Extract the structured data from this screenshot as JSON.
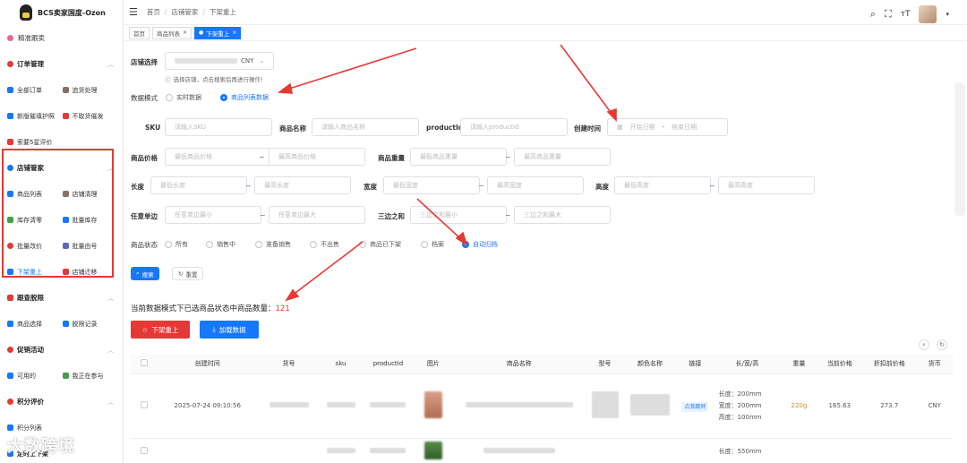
{
  "app_title": "BCS卖家国度-Ozon",
  "sidebar": {
    "top_item": "精准跟卖",
    "groups": [
      {
        "title": "订单管理",
        "items": [
          "全部订单",
          "追货处理",
          "新版催填护照",
          "不取货催发",
          "索要5星评价"
        ]
      },
      {
        "title": "店铺管家",
        "items": [
          "商品列表",
          "店铺清理",
          "库存清零",
          "批量库存",
          "批量改价",
          "批量由号",
          "下架重上",
          "店铺迁移"
        ]
      },
      {
        "title": "跟查脱限",
        "items": [
          "商品选择",
          "脱限记录"
        ]
      },
      {
        "title": "促销活动",
        "items": [
          "可用的",
          "我正在参与"
        ]
      },
      {
        "title": "积分评价",
        "items": [
          "积分列表",
          "定时上下架"
        ]
      }
    ],
    "active_item": "下架重上"
  },
  "breadcrumb": [
    "首页",
    "店铺管家",
    "下架重上"
  ],
  "tabs": [
    {
      "label": "首页"
    },
    {
      "label": "商品列表"
    },
    {
      "label": "下架重上"
    }
  ],
  "form": {
    "store_label": "店铺选择",
    "store_value": "CNY",
    "store_hint": "选择店铺，点击搜索后再进行操作!",
    "mode_label": "数据模式",
    "mode_options": [
      "实时数据",
      "商品列表数据"
    ],
    "sku_label": "SKU",
    "sku_placeholder": "请输入SKU",
    "name_label": "商品名称",
    "name_placeholder": "请输入商品名称",
    "pid_label": "productId",
    "pid_placeholder": "请输入productId",
    "created_label": "创建时间",
    "start_date": "开始日期",
    "date_sep": "-",
    "end_date": "结束日期",
    "price_label": "商品价格",
    "price_min": "最低商品价格",
    "price_max": "最高商品价格",
    "weight_label": "商品重量",
    "weight_min": "最低商品重量",
    "weight_max": "最高商品重量",
    "length_label": "长度",
    "length_min": "最低长度",
    "length_max": "最高长度",
    "width_label": "宽度",
    "width_min": "最低宽度",
    "width_max": "最高宽度",
    "height_label": "高度",
    "height_min": "最低高度",
    "height_max": "最高高度",
    "side_label": "任意单边",
    "side_min": "任意单边最小",
    "side_max": "任意单边最大",
    "sum_label": "三边之和",
    "sum_min": "三边之和最小",
    "sum_max": "三边之和最大",
    "tilde": "~",
    "status_label": "商品状态",
    "status_options": [
      "所有",
      "销售中",
      "准备销售",
      "不出售",
      "商品已下架",
      "档案",
      "自动归档"
    ],
    "search_btn": "搜索",
    "reset_btn": "重置"
  },
  "count_text": "当前数据模式下已选商品状态中商品数量：",
  "count_value": "121",
  "actions": {
    "relist": "下架重上",
    "load": "加载数据"
  },
  "table": {
    "headers": [
      "创建时间",
      "货号",
      "sku",
      "productId",
      "图片",
      "商品名称",
      "型号",
      "颜色名称",
      "链接",
      "长/宽/高",
      "重量",
      "当前价格",
      "折扣前价格",
      "货币"
    ],
    "rows": [
      {
        "created": "2025-07-24 09:10:56",
        "link": "点我跳转",
        "dims": [
          "长度：200mm",
          "宽度：200mm",
          "高度：100mm"
        ],
        "weight": "220g",
        "price": "165.63",
        "old_price": "273.7",
        "currency": "CNY"
      },
      {
        "dims": [
          "长度：550mm"
        ]
      }
    ]
  },
  "watermark": "大数跨境",
  "colors": {
    "primary": "#1677ff",
    "danger": "#e53935",
    "weight": "#e6862a"
  }
}
